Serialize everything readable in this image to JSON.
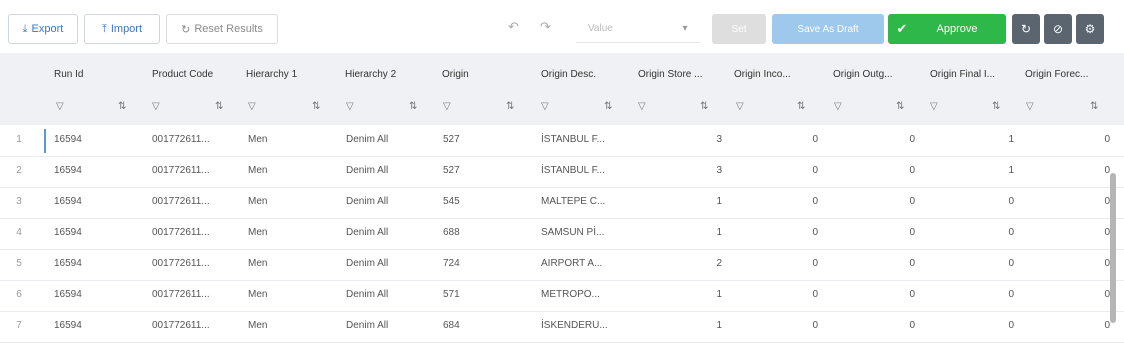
{
  "toolbar": {
    "export_label": "Export",
    "import_label": "Import",
    "reset_label": "Reset Results",
    "value_placeholder": "Value",
    "set_label": "Set",
    "save_draft_label": "Save As Draft",
    "approve_label": "Approve"
  },
  "columns": [
    "Run Id",
    "Product Code",
    "Hierarchy 1",
    "Hierarchy 2",
    "Origin",
    "Origin Desc.",
    "Origin Store ...",
    "Origin Inco...",
    "Origin Outg...",
    "Origin Final I...",
    "Origin Forec..."
  ],
  "rows": [
    {
      "n": "1",
      "run": "16594",
      "code": "001772611...",
      "h1": "Men",
      "h2": "Denim All",
      "origin": "527",
      "desc": "İSTANBUL F...",
      "store": "3",
      "inco": "0",
      "outg": "0",
      "fin": "1",
      "fore": "0"
    },
    {
      "n": "2",
      "run": "16594",
      "code": "001772611...",
      "h1": "Men",
      "h2": "Denim All",
      "origin": "527",
      "desc": "İSTANBUL F...",
      "store": "3",
      "inco": "0",
      "outg": "0",
      "fin": "1",
      "fore": "0"
    },
    {
      "n": "3",
      "run": "16594",
      "code": "001772611...",
      "h1": "Men",
      "h2": "Denim All",
      "origin": "545",
      "desc": "MALTEPE C...",
      "store": "1",
      "inco": "0",
      "outg": "0",
      "fin": "0",
      "fore": "0"
    },
    {
      "n": "4",
      "run": "16594",
      "code": "001772611...",
      "h1": "Men",
      "h2": "Denim All",
      "origin": "688",
      "desc": "SAMSUN Pİ...",
      "store": "1",
      "inco": "0",
      "outg": "0",
      "fin": "0",
      "fore": "0"
    },
    {
      "n": "5",
      "run": "16594",
      "code": "001772611...",
      "h1": "Men",
      "h2": "Denim All",
      "origin": "724",
      "desc": "AIRPORT A...",
      "store": "2",
      "inco": "0",
      "outg": "0",
      "fin": "0",
      "fore": "0"
    },
    {
      "n": "6",
      "run": "16594",
      "code": "001772611...",
      "h1": "Men",
      "h2": "Denim All",
      "origin": "571",
      "desc": "METROPO...",
      "store": "1",
      "inco": "0",
      "outg": "0",
      "fin": "0",
      "fore": "0"
    },
    {
      "n": "7",
      "run": "16594",
      "code": "001772611...",
      "h1": "Men",
      "h2": "Denim All",
      "origin": "684",
      "desc": "İSKENDERU...",
      "store": "1",
      "inco": "0",
      "outg": "0",
      "fin": "0",
      "fore": "0"
    }
  ],
  "colors": {
    "approve": "#2eb84a",
    "draft": "#9ec8ec",
    "accent": "#3a78c8"
  }
}
